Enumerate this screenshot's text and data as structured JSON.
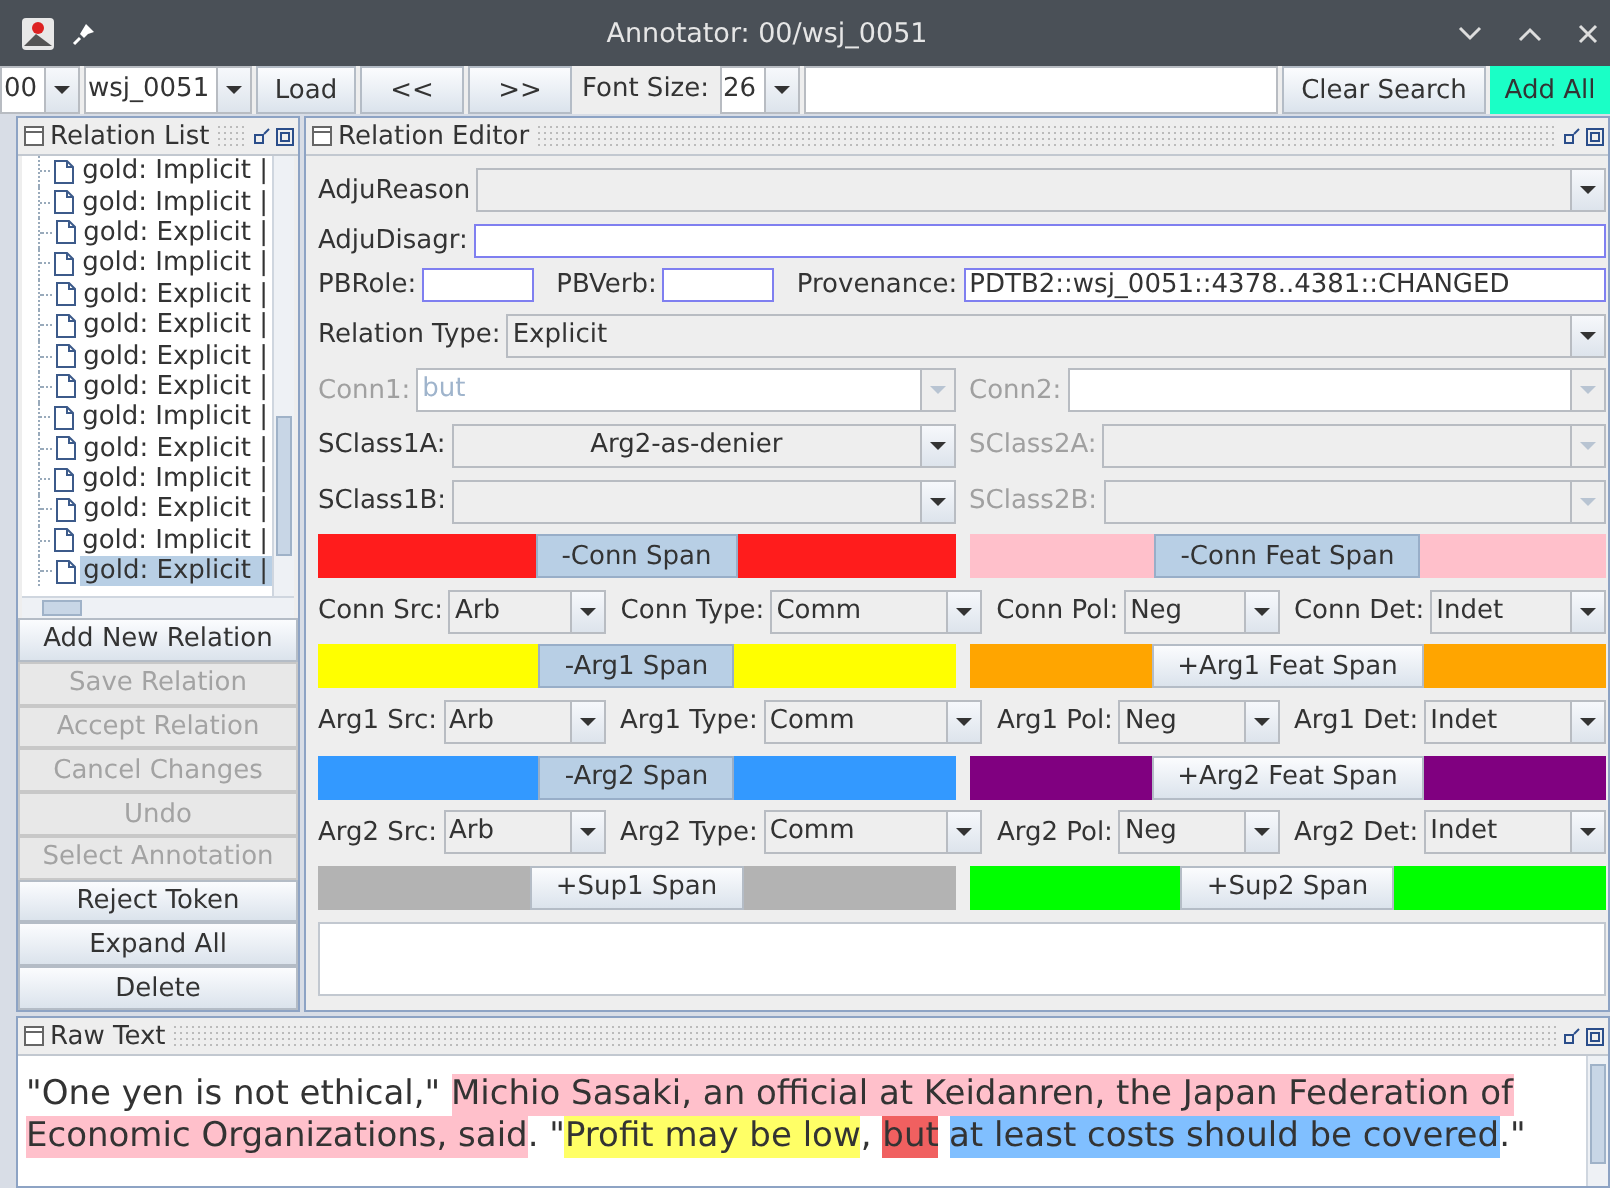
{
  "window": {
    "title": "Annotator: 00/wsj_0051"
  },
  "toolbar": {
    "section": "00",
    "file": "wsj_0051",
    "buttons": [
      "Load",
      "<<",
      ">>"
    ],
    "font_size_label": "Font Size:",
    "font_size": "26",
    "clear_search": "Clear Search",
    "add_all": "Add All"
  },
  "relation_list": {
    "title": "Relation List",
    "items": [
      {
        "label": "gold: Implicit |",
        "selected": false
      },
      {
        "label": "gold: Implicit |",
        "selected": false
      },
      {
        "label": "gold: Explicit |",
        "selected": false
      },
      {
        "label": "gold: Implicit |",
        "selected": false
      },
      {
        "label": "gold: Explicit |",
        "selected": false
      },
      {
        "label": "gold: Explicit |",
        "selected": false
      },
      {
        "label": "gold: Explicit |",
        "selected": false
      },
      {
        "label": "gold: Explicit |",
        "selected": false
      },
      {
        "label": "gold: Implicit |",
        "selected": false
      },
      {
        "label": "gold: Explicit |",
        "selected": false
      },
      {
        "label": "gold: Implicit |",
        "selected": false
      },
      {
        "label": "gold: Explicit |",
        "selected": false
      },
      {
        "label": "gold: Implicit |",
        "selected": false
      },
      {
        "label": "gold: Explicit |",
        "selected": true
      }
    ],
    "buttons": [
      {
        "label": "Add New Relation",
        "disabled": false
      },
      {
        "label": "Save Relation",
        "disabled": true
      },
      {
        "label": "Accept Relation",
        "disabled": true
      },
      {
        "label": "Cancel Changes",
        "disabled": true
      },
      {
        "label": "Undo",
        "disabled": true
      },
      {
        "label": "Select Annotation",
        "disabled": true
      },
      {
        "label": "Reject Token",
        "disabled": false
      },
      {
        "label": "Expand All",
        "disabled": false
      },
      {
        "label": "Delete",
        "disabled": false
      }
    ]
  },
  "relation_editor": {
    "title": "Relation Editor",
    "adju_reason": {
      "label": "AdjuReason"
    },
    "adju_disagr": {
      "label": "AdjuDisagr:"
    },
    "pb_role": {
      "label": "PBRole:"
    },
    "pb_verb": {
      "label": "PBVerb:"
    },
    "provenance": {
      "label": "Provenance:",
      "value": "PDTB2::wsj_0051::4378..4381::CHANGED"
    },
    "relation_type": {
      "label": "Relation Type:",
      "value": "Explicit"
    },
    "pair_rows": [
      {
        "cells": [
          {
            "label": "Conn1:",
            "value": "but",
            "kind": "editable",
            "disabled": true
          },
          {
            "label": "Conn2:",
            "kind": "editable",
            "disabled": true
          }
        ]
      },
      {
        "cells": [
          {
            "label": "SClass1A:",
            "value": "Arg2-as-denier",
            "kind": "combo",
            "disabled": false
          },
          {
            "label": "SClass2A:",
            "kind": "combo",
            "disabled": true
          }
        ]
      },
      {
        "cells": [
          {
            "label": "SClass1B:",
            "kind": "combo",
            "disabled": false
          },
          {
            "label": "SClass2B:",
            "kind": "combo",
            "disabled": true
          }
        ]
      }
    ],
    "blocks": [
      {
        "kind": "spans",
        "items": [
          {
            "label": "-Conn Span",
            "color": "#ff1c1c",
            "pressed": true
          },
          {
            "label": "-Conn Feat Span",
            "color": "#ffc0cb",
            "pressed": true
          }
        ]
      },
      {
        "kind": "attributes",
        "items": [
          {
            "label": "Conn Src:",
            "value": "Arb"
          },
          {
            "label": "Conn Type:",
            "value": "Comm"
          },
          {
            "label": "Conn Pol:",
            "value": "Neg"
          },
          {
            "label": "Conn Det:",
            "value": "Indet"
          }
        ]
      },
      {
        "kind": "spans",
        "items": [
          {
            "label": "-Arg1 Span",
            "color": "#ffff00",
            "pressed": true
          },
          {
            "label": "+Arg1 Feat Span",
            "color": "#ffa500",
            "pressed": false
          }
        ]
      },
      {
        "kind": "attributes",
        "items": [
          {
            "label": "Arg1 Src:",
            "value": "Arb"
          },
          {
            "label": "Arg1 Type:",
            "value": "Comm"
          },
          {
            "label": "Arg1 Pol:",
            "value": "Neg"
          },
          {
            "label": "Arg1 Det:",
            "value": "Indet"
          }
        ]
      },
      {
        "kind": "spans",
        "items": [
          {
            "label": "-Arg2 Span",
            "color": "#3399ff",
            "pressed": true
          },
          {
            "label": "+Arg2 Feat Span",
            "color": "#800080",
            "pressed": false
          }
        ]
      },
      {
        "kind": "attributes",
        "items": [
          {
            "label": "Arg2 Src:",
            "value": "Arb"
          },
          {
            "label": "Arg2 Type:",
            "value": "Comm"
          },
          {
            "label": "Arg2 Pol:",
            "value": "Neg"
          },
          {
            "label": "Arg2 Det:",
            "value": "Indet"
          }
        ]
      },
      {
        "kind": "spans",
        "items": [
          {
            "label": "+Sup1 Span",
            "color": "#b3b3b3",
            "pressed": false
          },
          {
            "label": "+Sup2 Span",
            "color": "#00ff00",
            "pressed": false
          }
        ]
      }
    ]
  },
  "raw_text": {
    "title": "Raw Text",
    "lines": [
      {
        "segments": [
          {
            "text": "\"One yen is not ethical,\" "
          },
          {
            "text": "Michio Sasaki, an official at Keidanren, the Japan Federation of",
            "color": "#ffc0cb"
          }
        ]
      },
      {
        "segments": [
          {
            "text": "Economic Organizations, said",
            "color": "#ffc0cb"
          },
          {
            "text": ". \""
          },
          {
            "text": "Profit may be low",
            "color": "#ffff66"
          },
          {
            "text": ", "
          },
          {
            "text": "but",
            "color": "#f06060"
          },
          {
            "text": "at least costs should be covered",
            "color": "#80bfff"
          },
          {
            "text": ".\""
          }
        ]
      }
    ]
  }
}
